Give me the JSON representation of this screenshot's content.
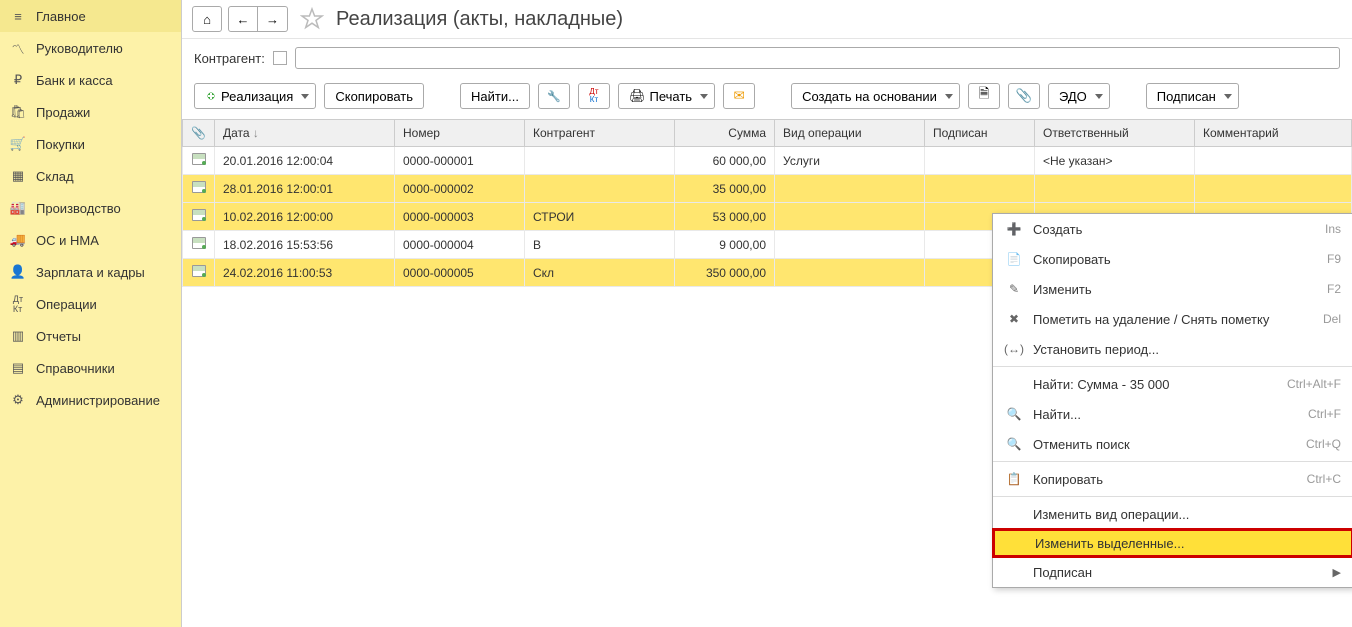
{
  "sidebar": {
    "items": [
      {
        "label": "Главное",
        "icon": "hamburger"
      },
      {
        "label": "Руководителю",
        "icon": "trend"
      },
      {
        "label": "Банк и касса",
        "icon": "ruble"
      },
      {
        "label": "Продажи",
        "icon": "bag"
      },
      {
        "label": "Покупки",
        "icon": "cart"
      },
      {
        "label": "Склад",
        "icon": "boxes"
      },
      {
        "label": "Производство",
        "icon": "factory"
      },
      {
        "label": "ОС и НМА",
        "icon": "truck"
      },
      {
        "label": "Зарплата и кадры",
        "icon": "person"
      },
      {
        "label": "Операции",
        "icon": "dtct"
      },
      {
        "label": "Отчеты",
        "icon": "chart"
      },
      {
        "label": "Справочники",
        "icon": "book"
      },
      {
        "label": "Администрирование",
        "icon": "gear"
      }
    ]
  },
  "header": {
    "title": "Реализация (акты, накладные)"
  },
  "filter": {
    "label": "Контрагент:",
    "value": ""
  },
  "toolbar": {
    "create_label": "Реализация",
    "copy_label": "Скопировать",
    "find_label": "Найти...",
    "print_label": "Печать",
    "create_based_label": "Создать на основании",
    "edo_label": "ЭДО",
    "signed_label": "Подписан"
  },
  "table": {
    "columns": [
      "",
      "Дата",
      "Номер",
      "Контрагент",
      "Сумма",
      "Вид операции",
      "Подписан",
      "Ответственный",
      "Комментарий"
    ],
    "rows": [
      {
        "date": "20.01.2016 12:00:04",
        "num": "0000-000001",
        "contr": "",
        "sum": "60 000,00",
        "op": "Услуги",
        "signed": "",
        "resp": "<Не указан>",
        "sel": false
      },
      {
        "date": "28.01.2016 12:00:01",
        "num": "0000-000002",
        "contr": "",
        "sum": "35 000,00",
        "op": "",
        "signed": "",
        "resp": "",
        "sel": true
      },
      {
        "date": "10.02.2016 12:00:00",
        "num": "0000-000003",
        "contr": "СТРОИ",
        "sum": "53 000,00",
        "op": "",
        "signed": "",
        "resp": "",
        "sel": true
      },
      {
        "date": "18.02.2016 15:53:56",
        "num": "0000-000004",
        "contr": "В",
        "sum": "9 000,00",
        "op": "",
        "signed": "",
        "resp": "",
        "sel": false
      },
      {
        "date": "24.02.2016 11:00:53",
        "num": "0000-000005",
        "contr": "Скл",
        "sum": "350 000,00",
        "op": "",
        "signed": "",
        "resp": "",
        "sel": true
      }
    ]
  },
  "context_menu": {
    "items": [
      {
        "label": "Создать",
        "shortcut": "Ins",
        "icon": "plus"
      },
      {
        "label": "Скопировать",
        "shortcut": "F9",
        "icon": "copy"
      },
      {
        "label": "Изменить",
        "shortcut": "F2",
        "icon": "edit"
      },
      {
        "label": "Пометить на удаление / Снять пометку",
        "shortcut": "Del",
        "icon": "delete"
      },
      {
        "label": "Установить период...",
        "shortcut": "",
        "icon": "period",
        "sep_after": true
      },
      {
        "label": "Найти: Сумма - 35 000",
        "shortcut": "Ctrl+Alt+F",
        "icon": ""
      },
      {
        "label": "Найти...",
        "shortcut": "Ctrl+F",
        "icon": "search"
      },
      {
        "label": "Отменить поиск",
        "shortcut": "Ctrl+Q",
        "icon": "cancel-search",
        "sep_after": true
      },
      {
        "label": "Копировать",
        "shortcut": "Ctrl+C",
        "icon": "clipboard",
        "sep_after": true
      },
      {
        "label": "Изменить вид операции...",
        "shortcut": "",
        "icon": ""
      },
      {
        "label": "Изменить выделенные...",
        "shortcut": "",
        "icon": "",
        "highlight": true
      },
      {
        "label": "Подписан",
        "shortcut": "",
        "icon": "",
        "submenu": true
      }
    ]
  }
}
